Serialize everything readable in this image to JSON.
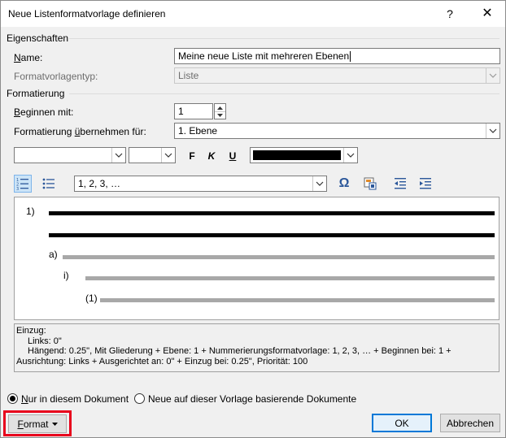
{
  "dialog": {
    "title": "Neue Listenformatvorlage definieren",
    "help_glyph": "?",
    "close_glyph": "✕"
  },
  "properties": {
    "section_label": "Eigenschaften",
    "name_label": "Name:",
    "name_value": "Meine neue Liste mit mehreren Ebenen",
    "type_label": "Formatvorlagentyp:",
    "type_value": "Liste"
  },
  "formatting": {
    "section_label": "Formatierung",
    "start_label": "Beginnen mit:",
    "start_value": "1",
    "apply_label": "Formatierung übernehmen für:",
    "apply_value": "1. Ebene",
    "font_value": "",
    "size_value": "",
    "bold_label": "F",
    "italic_label": "K",
    "underline_label": "U",
    "color_value": "#000000",
    "number_style_value": "1, 2, 3, …",
    "symbol_glyph": "Ω"
  },
  "preview": {
    "levels": [
      "1)",
      "a)",
      "i)",
      "(1)"
    ]
  },
  "description": {
    "lines": [
      "Einzug:",
      "Links:  0\"",
      "Hängend:  0.25\", Mit Gliederung + Ebene: 1 + Nummerierungsformatvorlage: 1, 2, 3, … + Beginnen bei: 1 +",
      "Ausrichtung: Links + Ausgerichtet an:  0\" + Einzug bei:  0.25\", Priorität: 100"
    ]
  },
  "scope": {
    "option_document": "Nur in diesem Dokument",
    "option_template": "Neue auf dieser Vorlage basierende Dokumente",
    "selected": "document"
  },
  "buttons": {
    "format": "Format",
    "ok": "OK",
    "cancel": "Abbrechen"
  },
  "colors": {
    "highlight": "#e8001c",
    "accent": "#0078d7",
    "icon_blue": "#2b579a"
  }
}
